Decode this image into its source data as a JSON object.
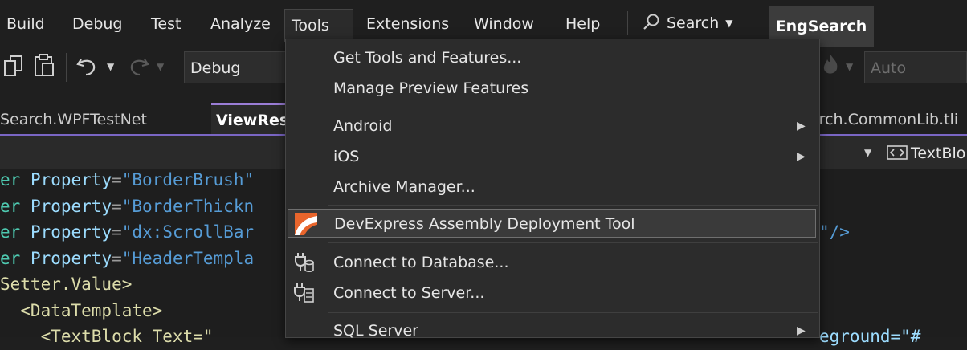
{
  "menubar": {
    "items": [
      "Build",
      "Debug",
      "Test",
      "Analyze",
      "Tools",
      "Extensions",
      "Window",
      "Help"
    ],
    "search_label": "Search",
    "profile_label": "EngSearch"
  },
  "toolbar": {
    "config_value": "Debug",
    "platform_value": "Auto"
  },
  "tabs": {
    "left": "Search.WPFTestNet",
    "active": "ViewRes",
    "right": "arch.CommonLib.tli"
  },
  "navbar": {
    "right_label": "TextBlo"
  },
  "code": {
    "l1_a": "er ",
    "l1_b": "Property",
    "l1_c": "=",
    "l1_d": "\"BorderBrush\"",
    "l2_a": "er ",
    "l2_b": "Property",
    "l2_c": "=",
    "l2_d": "\"BorderThickn",
    "l3_a": "er ",
    "l3_b": "Property",
    "l3_c": "=",
    "l3_d": "\"dx:ScrollBar",
    "l3_tail": "\"/>",
    "l4_a": "er ",
    "l4_b": "Property",
    "l4_c": "=",
    "l4_d": "\"HeaderTempla",
    "l5": "Setter.Value>",
    "l6": "  <DataTemplate>",
    "l7": "    <TextBlock Text=\"",
    "l7_tail": "eground=\"#"
  },
  "tools_menu": {
    "items": [
      {
        "label": "Get Tools and Features..."
      },
      {
        "label": "Manage Preview Features"
      },
      {
        "label": "Android"
      },
      {
        "label": "iOS"
      },
      {
        "label": "Archive Manager..."
      },
      {
        "label": "DevExpress Assembly Deployment Tool"
      },
      {
        "label": "Connect to Database..."
      },
      {
        "label": "Connect to Server..."
      },
      {
        "label": "SQL Server"
      }
    ]
  },
  "colors": {
    "accent": "#7a66c4",
    "menu_bg": "#2c2c2c",
    "hover_border": "#6f6f6f"
  }
}
